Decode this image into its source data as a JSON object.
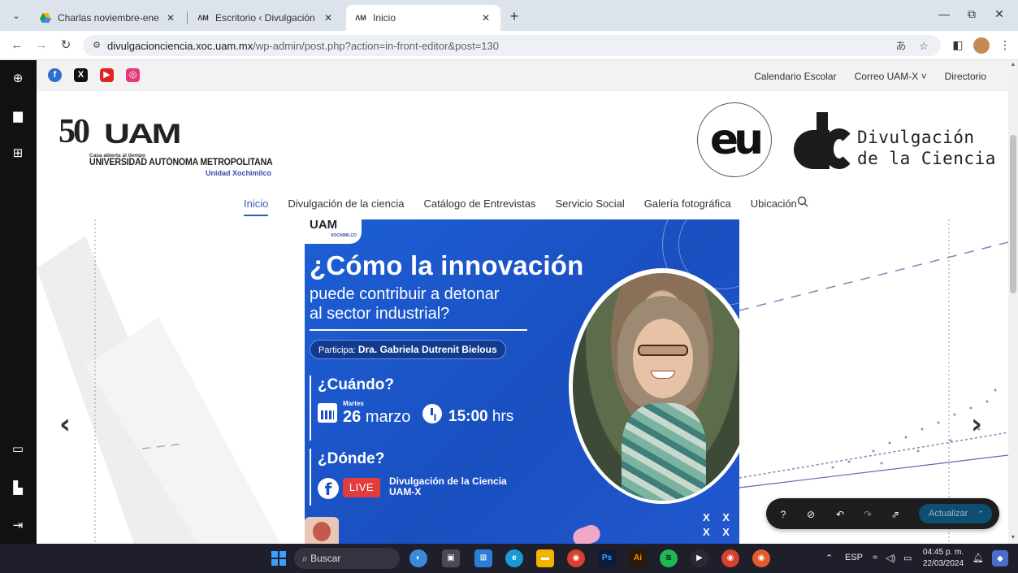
{
  "browser": {
    "tabs": [
      {
        "title": "Charlas noviembre-enero - Goo",
        "favicon": "google-drive-icon",
        "active": false
      },
      {
        "title": "Escritorio ‹ Divulgación de la Ci",
        "favicon": "uam-icon",
        "active": false
      },
      {
        "title": "Inicio",
        "favicon": "uam-icon",
        "active": true
      }
    ],
    "url_host": "divulgacionciencia.xoc.uam.mx",
    "url_path": "/wp-admin/post.php?action=in-front-editor&post=130"
  },
  "colors": {
    "accent": "#3061b8",
    "poster_blue": "#1a4fc0",
    "editor_dark": "#1e1e1e",
    "live_red": "#e23c3c",
    "update_button": "#0d4f73"
  },
  "topbar": {
    "social": [
      {
        "name": "facebook",
        "glyph": "f",
        "color": "#2d6fd1"
      },
      {
        "name": "x",
        "glyph": "X",
        "color": "#111111"
      },
      {
        "name": "youtube",
        "glyph": "▶",
        "color": "#e02424"
      },
      {
        "name": "instagram",
        "glyph": "◎",
        "color": "#e23a7a"
      }
    ],
    "links": [
      "Calendario Escolar",
      "Correo UAM-X ˅",
      "Directorio"
    ]
  },
  "header": {
    "uam_logo": {
      "number": "50",
      "mark": "UAM",
      "tagline": "Casa abierta al tiempo",
      "university": "UNIVERSIDAD AUTÓNOMA METROPOLITANA",
      "unit": "Unidad Xochimilco"
    },
    "eu_logo": "eu",
    "dc_text_line1": "Divulgación",
    "dc_text_line2": "de la Ciencia"
  },
  "nav": {
    "items": [
      "Inicio",
      "Divulgación de la ciencia",
      "Catálogo de Entrevistas",
      "Servicio Social",
      "Galería fotográfica",
      "Ubicación"
    ],
    "active_index": 0
  },
  "poster": {
    "logo_mark": "UAM",
    "logo_sub": "XOCHIMILCO",
    "title": "¿Cómo la innovación",
    "subtitle_line1": "puede contribuir a detonar",
    "subtitle_line2": "al sector industrial?",
    "participant_label": "Participa:",
    "participant_name": "Dra. Gabriela Dutrenit Bielous",
    "when_heading": "¿Cuándo?",
    "weekday": "Martes",
    "day_num": "26",
    "day_month": "marzo",
    "hour": "15:00",
    "hour_unit": "hrs",
    "where_heading": "¿Dónde?",
    "live_label": "LIVE",
    "channel_line1": "Divulgación de la Ciencia",
    "channel_line2": "UAM-X",
    "corner_marks": "X X\nX X"
  },
  "slider": {
    "prev": "‹",
    "next": "›"
  },
  "editor_toolbar": {
    "update_label": "Actualizar"
  },
  "taskbar": {
    "search_label": "Buscar",
    "lang": "ESP",
    "time": "04:45 p. m.",
    "date": "22/03/2024"
  }
}
